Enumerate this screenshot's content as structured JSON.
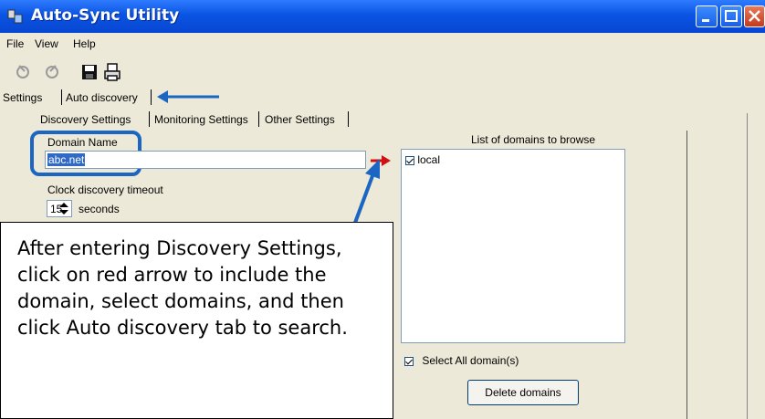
{
  "window": {
    "title": "Auto-Sync Utility",
    "buttons": {
      "minimize": "minimize-icon",
      "maximize": "maximize-icon",
      "close": "close-icon"
    }
  },
  "menu": {
    "items": [
      "File",
      "View",
      "Help"
    ]
  },
  "toolbar": {
    "icons": [
      "connect-icon",
      "disconnect-icon",
      "save-icon",
      "print-icon"
    ]
  },
  "tabs": {
    "main": [
      "Settings",
      "Auto discovery"
    ],
    "sub": [
      "Discovery Settings",
      "Monitoring Settings",
      "Other Settings"
    ]
  },
  "discovery": {
    "domain_label": "Domain Name",
    "domain_value": "abc.net",
    "timeout_label": "Clock discovery timeout",
    "timeout_value": "15",
    "timeout_unit": "seconds",
    "list_title": "List of domains to browse",
    "list_items": [
      {
        "label": "local",
        "checked": true
      }
    ],
    "select_all_label": "Select All domain(s)",
    "delete_label": "Delete domains"
  },
  "annotation": {
    "text": "After entering Discovery Settings, click on red arrow to include the domain, select domains, and then click Auto discovery tab to search.",
    "highlight_color": "#1a66c2",
    "arrow_color": "#1a66c2"
  },
  "colors": {
    "titlebar": "#0a54e3",
    "window_bg": "#ece9d8",
    "red_arrow": "#d01010"
  }
}
